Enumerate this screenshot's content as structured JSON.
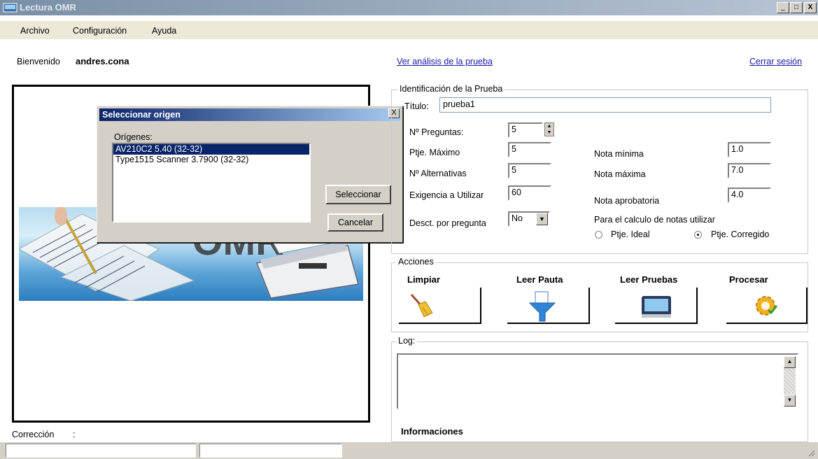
{
  "window": {
    "title": "Lectura OMR",
    "controls": [
      "_",
      "□",
      "X"
    ]
  },
  "menu": [
    "Archivo",
    "Configuración",
    "Ayuda"
  ],
  "header": {
    "welcome_label": "Bienvenido",
    "username": "andres.cona",
    "analysis_link": "Ver análisis de la prueba",
    "logout_link": "Cerrar sesión"
  },
  "dialog": {
    "title": "Seleccionar origen",
    "close": "X",
    "sources_label": "Orígenes:",
    "sources": [
      "AV210C2 5.40 (32-32)",
      "Type1515 Scanner 3.7900 (32-32)"
    ],
    "selected_index": 0,
    "select_button": "Seleccionar",
    "cancel_button": "Cancelar"
  },
  "test_id": {
    "legend": "Identificación de la Prueba",
    "title_label": "Título:",
    "title_value": "prueba1",
    "questions_label": "Nº Preguntas:",
    "questions_value": "5",
    "max_score_label": "Ptje. Máximo",
    "max_score_value": "5",
    "alternatives_label": "Nº Alternativas",
    "alternatives_value": "5",
    "requirement_label": "Exigencia a Utilizar",
    "requirement_value": "60",
    "discount_label": "Desct. por pregunta",
    "discount_value": "No",
    "min_grade_label": "Nota mínima",
    "min_grade_value": "1.0",
    "max_grade_label": "Nota máxima",
    "max_grade_value": "7.0",
    "pass_grade_label": "Nota aprobatoria",
    "pass_grade_value": "4.0",
    "calc_label": "Para el calculo de notas utilizar",
    "ideal_option": "Ptje. Ideal",
    "corrected_option": "Ptje. Corregido",
    "selected_option": "corrected"
  },
  "actions": {
    "legend": "Acciones",
    "buttons": [
      "Limpiar",
      "Leer Pauta",
      "Leer Pruebas",
      "Procesar"
    ]
  },
  "log": {
    "legend": "Log:",
    "info_label": "Informaciones"
  },
  "footer": {
    "correction_label": "Corrección",
    "correction_sep": ":"
  },
  "colors": {
    "title_active": "#0a246a",
    "link": "#1a1aa8",
    "face": "#d4d0c8"
  }
}
